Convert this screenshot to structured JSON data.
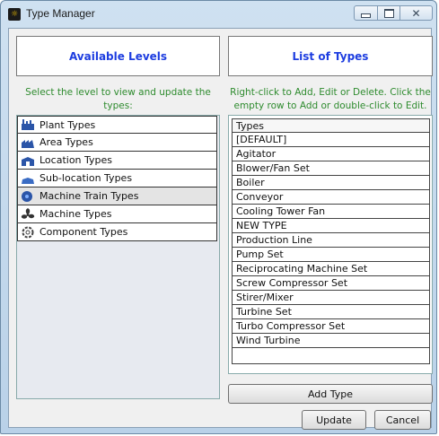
{
  "window": {
    "title": "Type Manager",
    "controls": {
      "minimize": "—",
      "maximize": "",
      "close": "✕"
    }
  },
  "levels": {
    "heading": "Available Levels",
    "instruction": "Select the level to view and update the types:",
    "items": [
      {
        "label": "Plant Types",
        "icon": "plant-icon"
      },
      {
        "label": "Area Types",
        "icon": "area-icon"
      },
      {
        "label": "Location Types",
        "icon": "location-icon"
      },
      {
        "label": "Sub-location Types",
        "icon": "sub-location-icon"
      },
      {
        "label": "Machine Train Types",
        "icon": "machine-train-icon"
      },
      {
        "label": "Machine Types",
        "icon": "machine-icon"
      },
      {
        "label": "Component Types",
        "icon": "component-icon"
      }
    ],
    "selected": "Machine Train Types"
  },
  "types": {
    "heading": "List of Types",
    "instruction": "Right-click to Add, Edit or Delete. Click the empty row to Add or double-click to Edit.",
    "column_header": "Types",
    "rows": [
      "[DEFAULT]",
      "Agitator",
      "Blower/Fan Set",
      "Boiler",
      "Conveyor",
      "Cooling Tower Fan",
      "NEW TYPE",
      "Production Line",
      "Pump Set",
      "Reciprocating Machine Set",
      "Screw Compressor Set",
      "Stirer/Mixer",
      "Turbine Set",
      "Turbo Compressor Set",
      "Wind Turbine"
    ],
    "add_button": "Add Type"
  },
  "footer": {
    "update_button": "Update",
    "cancel_button": "Cancel"
  },
  "colors": {
    "heading": "#1d3de0",
    "instruction": "#2e8b2e",
    "title_bar": "#b9d1e8"
  }
}
